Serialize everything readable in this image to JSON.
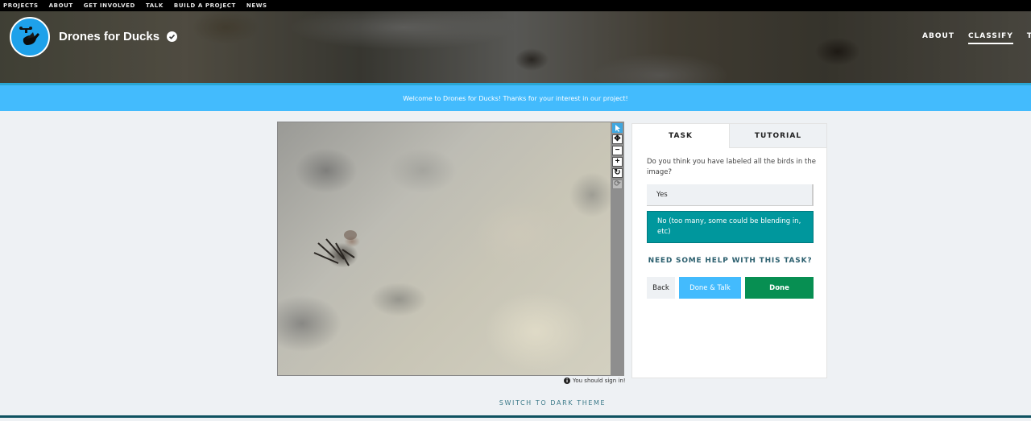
{
  "topnav": [
    "PROJECTS",
    "ABOUT",
    "GET INVOLVED",
    "TALK",
    "BUILD A PROJECT",
    "NEWS"
  ],
  "project": {
    "title": "Drones for Ducks",
    "logo_icon": "duck-drone-logo",
    "verified_icon": "check-circle-icon"
  },
  "project_nav": [
    {
      "label": "ABOUT",
      "active": false
    },
    {
      "label": "CLASSIFY",
      "active": true
    },
    {
      "label": "T",
      "active": false
    }
  ],
  "banner": {
    "text": "Welcome to Drones for Ducks! Thanks for your interest in our project!"
  },
  "viewer": {
    "tools": [
      "pointer-icon",
      "move-icon",
      "zoom-out-icon",
      "zoom-in-icon",
      "rotate-icon",
      "reset-icon"
    ],
    "signin_note": "You should sign in!"
  },
  "task": {
    "tabs": [
      "TASK",
      "TUTORIAL"
    ],
    "question": "Do you think you have labeled all the birds in the image?",
    "answers": [
      "Yes",
      "No (too many, some could be blending in, etc)"
    ],
    "selected_answer": 1,
    "help_link": "NEED SOME HELP WITH THIS TASK?",
    "buttons": {
      "back": "Back",
      "done_talk": "Done & Talk",
      "done": "Done"
    }
  },
  "footer": {
    "theme_toggle": "SWITCH TO DARK THEME"
  },
  "colors": {
    "accent_blue": "#43bbfd",
    "selected_teal": "#00979d",
    "done_green": "#078f52"
  }
}
